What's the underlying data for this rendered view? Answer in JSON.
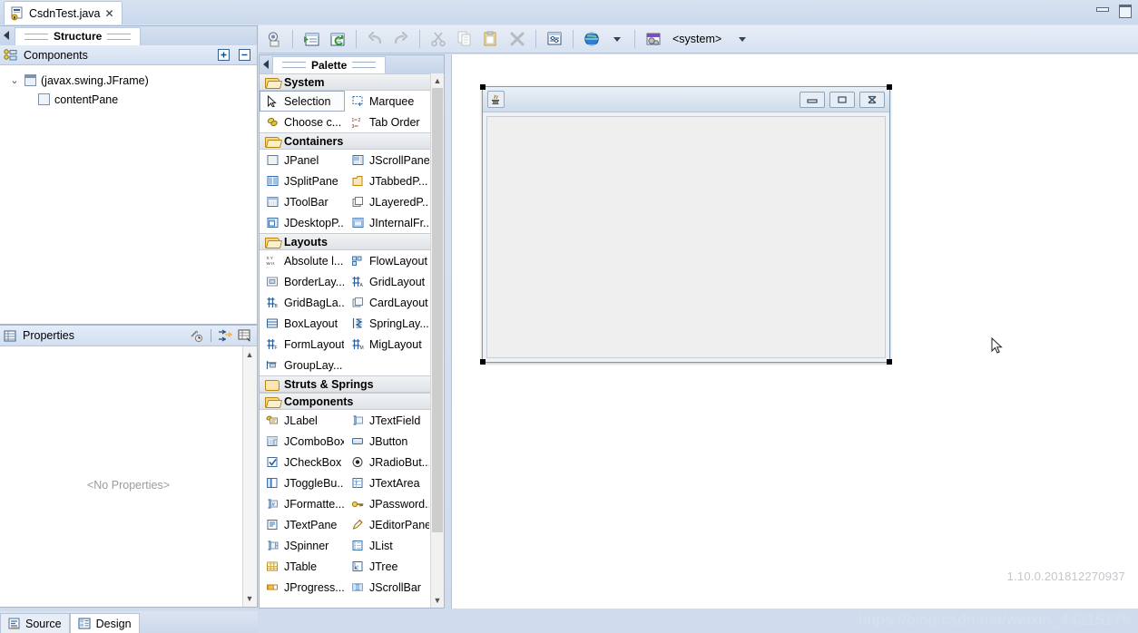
{
  "window": {
    "controls": [
      {
        "name": "minimize-button",
        "glyph": "minimize"
      },
      {
        "name": "maximize-button",
        "glyph": "maximize"
      }
    ]
  },
  "editor_tab": {
    "label": "CsdnTest.java",
    "close": "✕",
    "icon": "java-file-icon"
  },
  "structure_view": {
    "tab_label": "Structure",
    "collapse_arrow": "◀",
    "components_pane": {
      "title": "Components",
      "icon": "components-icon",
      "expand_all": "+",
      "collapse_all": "−",
      "tree": [
        {
          "label": "(javax.swing.JFrame)",
          "twisty": "⌄",
          "depth": 0,
          "icon": "frame-icon"
        },
        {
          "label": "contentPane",
          "twisty": "",
          "depth": 1,
          "icon": "panel-icon"
        }
      ]
    }
  },
  "properties_view": {
    "title": "Properties",
    "icon": "properties-icon",
    "toolbar": [
      {
        "name": "restore-default-button",
        "icon": "restore-default-icon"
      },
      {
        "name": "show-advanced-button",
        "icon": "advanced-properties-icon"
      },
      {
        "name": "show-events-button",
        "icon": "events-icon"
      }
    ],
    "empty_text": "<No Properties>",
    "scroll_up": "⌃",
    "scroll_down": "⌄"
  },
  "palette": {
    "tab_label": "Palette",
    "collapse_arrow": "◀",
    "scroll_up": "⌃",
    "scroll_down": "⌄",
    "categories": [
      {
        "name": "System",
        "folder": "open",
        "items": [
          {
            "label": "Selection",
            "icon": "cursor-arrow-icon",
            "selected": true
          },
          {
            "label": "Marquee",
            "icon": "marquee-icon",
            "selected": false
          },
          {
            "label": "Choose c...",
            "icon": "choose-component-icon",
            "selected": false
          },
          {
            "label": "Tab Order",
            "icon": "tab-order-icon",
            "selected": false
          }
        ]
      },
      {
        "name": "Containers",
        "folder": "open",
        "items": [
          {
            "label": "JPanel",
            "icon": "jpanel-icon",
            "selected": false
          },
          {
            "label": "JScrollPane",
            "icon": "jscrollpane-icon",
            "selected": false
          },
          {
            "label": "JSplitPane",
            "icon": "jsplitpane-icon",
            "selected": false
          },
          {
            "label": "JTabbedP...",
            "icon": "jtabbedpane-icon",
            "selected": false
          },
          {
            "label": "JToolBar",
            "icon": "jtoolbar-icon",
            "selected": false
          },
          {
            "label": "JLayeredP...",
            "icon": "jlayeredpane-icon",
            "selected": false
          },
          {
            "label": "JDesktopP...",
            "icon": "jdesktoppane-icon",
            "selected": false
          },
          {
            "label": "JInternalFr...",
            "icon": "jinternalframe-icon",
            "selected": false
          }
        ]
      },
      {
        "name": "Layouts",
        "folder": "open",
        "items": [
          {
            "label": "Absolute l...",
            "icon": "absolute-layout-icon",
            "selected": false
          },
          {
            "label": "FlowLayout",
            "icon": "flowlayout-icon",
            "selected": false
          },
          {
            "label": "BorderLay...",
            "icon": "borderlayout-icon",
            "selected": false
          },
          {
            "label": "GridLayout",
            "icon": "gridlayout-icon",
            "selected": false
          },
          {
            "label": "GridBagLa...",
            "icon": "gridbaglayout-icon",
            "selected": false
          },
          {
            "label": "CardLayout",
            "icon": "cardlayout-icon",
            "selected": false
          },
          {
            "label": "BoxLayout",
            "icon": "boxlayout-icon",
            "selected": false
          },
          {
            "label": "SpringLay...",
            "icon": "springlayout-icon",
            "selected": false
          },
          {
            "label": "FormLayout",
            "icon": "formlayout-icon",
            "selected": false
          },
          {
            "label": "MigLayout",
            "icon": "miglayout-icon",
            "selected": false
          },
          {
            "label": "GroupLay...",
            "icon": "grouplayout-icon",
            "selected": false
          }
        ]
      },
      {
        "name": "Struts & Springs",
        "folder": "closed",
        "items": []
      },
      {
        "name": "Components",
        "folder": "open",
        "items": [
          {
            "label": "JLabel",
            "icon": "jlabel-icon",
            "selected": false
          },
          {
            "label": "JTextField",
            "icon": "jtextfield-icon",
            "selected": false
          },
          {
            "label": "JComboBox",
            "icon": "jcombobox-icon",
            "selected": false
          },
          {
            "label": "JButton",
            "icon": "jbutton-icon",
            "selected": false
          },
          {
            "label": "JCheckBox",
            "icon": "jcheckbox-icon",
            "selected": false
          },
          {
            "label": "JRadioBut...",
            "icon": "jradiobutton-icon",
            "selected": false
          },
          {
            "label": "JToggleBu...",
            "icon": "jtogglebutton-icon",
            "selected": false
          },
          {
            "label": "JTextArea",
            "icon": "jtextarea-icon",
            "selected": false
          },
          {
            "label": "JFormatte...",
            "icon": "jformattedtextfield-icon",
            "selected": false
          },
          {
            "label": "JPassword...",
            "icon": "jpasswordfield-icon",
            "selected": false
          },
          {
            "label": "JTextPane",
            "icon": "jtextpane-icon",
            "selected": false
          },
          {
            "label": "JEditorPane",
            "icon": "jeditorpane-icon",
            "selected": false
          },
          {
            "label": "JSpinner",
            "icon": "jspinner-icon",
            "selected": false
          },
          {
            "label": "JList",
            "icon": "jlist-icon",
            "selected": false
          },
          {
            "label": "JTable",
            "icon": "jtable-icon",
            "selected": false
          },
          {
            "label": "JTree",
            "icon": "jtree-icon",
            "selected": false
          },
          {
            "label": "JProgress...",
            "icon": "jprogressbar-icon",
            "selected": false
          },
          {
            "label": "JScrollBar",
            "icon": "jscrollbar-icon",
            "selected": false
          }
        ]
      }
    ]
  },
  "toolbar": {
    "buttons": [
      {
        "name": "test-button",
        "icon": "test-preview-icon",
        "enabled": true
      },
      {
        "name": "open-source-button",
        "icon": "source-view-icon",
        "enabled": true
      },
      {
        "name": "refresh-button",
        "icon": "refresh-icon",
        "enabled": true
      },
      {
        "name": "undo-button",
        "icon": "undo-icon",
        "enabled": false
      },
      {
        "name": "redo-button",
        "icon": "redo-icon",
        "enabled": false
      },
      {
        "name": "cut-button",
        "icon": "scissors-icon",
        "enabled": false
      },
      {
        "name": "copy-button",
        "icon": "copy-icon",
        "enabled": false
      },
      {
        "name": "paste-button",
        "icon": "paste-icon",
        "enabled": false
      },
      {
        "name": "delete-button",
        "icon": "delete-x-icon",
        "enabled": false
      },
      {
        "name": "properties-button",
        "icon": "properties-panel-icon",
        "enabled": true
      }
    ],
    "locale_dropdown": {
      "icon": "globe-icon",
      "arrow": "▾"
    },
    "laf_dropdown": {
      "icon": "look-and-feel-icon",
      "label": "<system>",
      "arrow": "▾"
    }
  },
  "design_canvas": {
    "frame": {
      "title_icon": "java-coffee-icon",
      "minimize": "minimize",
      "maximize": "maximize",
      "close": "close"
    },
    "version": "1.10.0.201812270937",
    "watermark": "https://blog.csdn.net/weixin_44215175"
  },
  "bottom_tabs": [
    {
      "label": "Source",
      "icon": "source-icon",
      "active": false
    },
    {
      "label": "Design",
      "icon": "design-icon",
      "active": true
    }
  ]
}
